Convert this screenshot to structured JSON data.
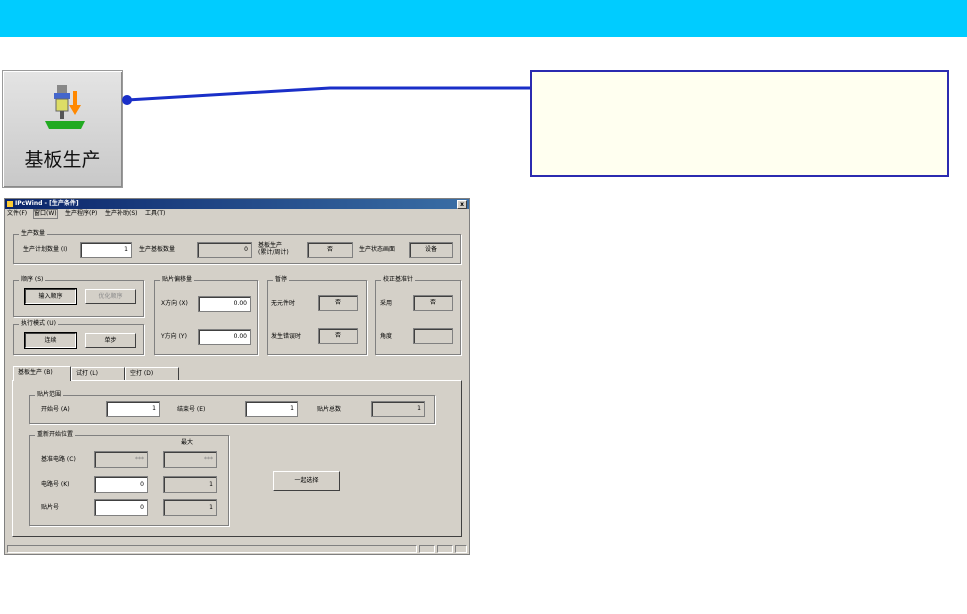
{
  "launcher": {
    "label": "基板生产",
    "icon": "mounter-head-icon"
  },
  "window": {
    "title": "IPcWind - [生产条件]",
    "close": "x",
    "menu": [
      "文件(F)",
      "窗口(W)",
      "生产程序(P)",
      "生产补助(S)",
      "工具(T)"
    ]
  },
  "prod_qty": {
    "group": "生产数量",
    "plan_label": "生产计划数量 (I)",
    "plan_value": "1",
    "produced_label": "生产基板数量",
    "produced_value": "0",
    "board_prod_label_1": "基板生产",
    "board_prod_label_2": "(累计/周计)",
    "board_prod_value": "否",
    "status_screen_label": "生产状态画面",
    "status_screen_value": "设备"
  },
  "order": {
    "group": "顺序 (S)",
    "input_btn": "输入顺序",
    "optimize_btn": "优化顺序"
  },
  "exec_mode": {
    "group": "执行模式 (U)",
    "continuous_btn": "连续",
    "single_btn": "单步"
  },
  "offset": {
    "group": "贴片偏移量",
    "x_label": "X方向 (X)",
    "x_value": "0.00",
    "y_label": "Y方向 (Y)",
    "y_value": "0.00"
  },
  "pause": {
    "group": "暂停",
    "no_part_label": "无元件时",
    "no_part_value": "否",
    "error_label": "发生错误时",
    "error_value": "否"
  },
  "calib": {
    "group": "校正基准针",
    "use_label": "采用",
    "use_value": "否",
    "angle_label": "角度",
    "angle_value": ""
  },
  "tabs": [
    "基板生产 (B)",
    "试打 (L)",
    "空打 (D)"
  ],
  "range": {
    "group": "贴片范围",
    "start_label": "开始号 (A)",
    "start_value": "1",
    "end_label": "结束号 (E)",
    "end_value": "1",
    "step_label": "贴片总数",
    "step_value": "1"
  },
  "restart": {
    "group": "重新开始位置",
    "max_header": "最大",
    "circuit_label": "基准电路 (C)",
    "circuit_value": "***",
    "circuit_max": "***",
    "block_label": "电路号 (K)",
    "block_value": "0",
    "block_max": "1",
    "mount_label": "贴片号",
    "mount_value": "0",
    "mount_max": "1",
    "batch_btn": "一起选择"
  }
}
